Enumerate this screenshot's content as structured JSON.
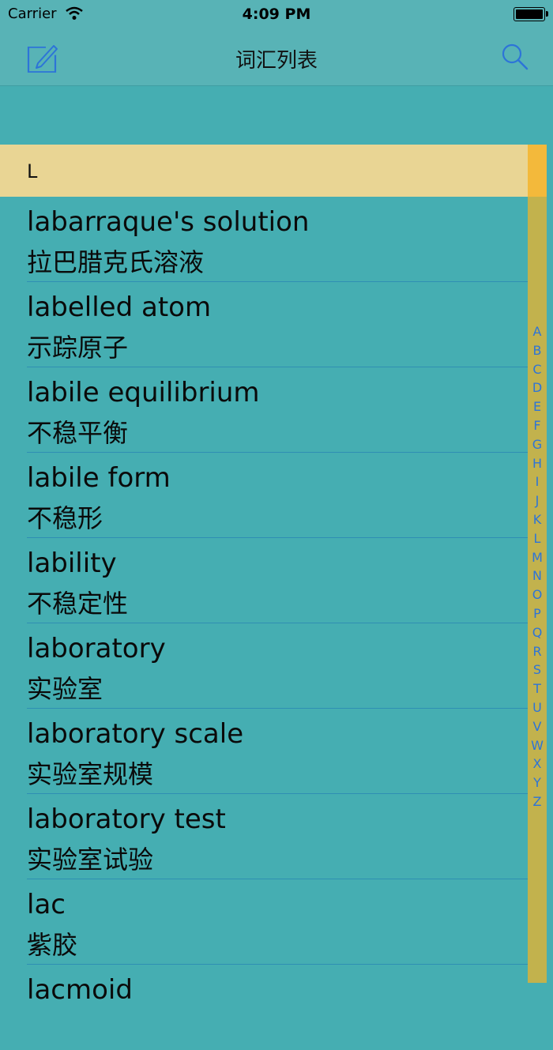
{
  "status": {
    "carrier": "Carrier",
    "time": "4:09 PM"
  },
  "nav": {
    "title": "词汇列表"
  },
  "section": {
    "letter": "L"
  },
  "words": [
    {
      "term": "labarraque's solution",
      "meaning": "拉巴腊克氏溶液"
    },
    {
      "term": "labelled atom",
      "meaning": "示踪原子"
    },
    {
      "term": "labile equilibrium",
      "meaning": "不稳平衡"
    },
    {
      "term": "labile form",
      "meaning": "不稳形"
    },
    {
      "term": "lability",
      "meaning": "不稳定性"
    },
    {
      "term": "laboratory",
      "meaning": "实验室"
    },
    {
      "term": "laboratory scale",
      "meaning": "实验室规模"
    },
    {
      "term": "laboratory test",
      "meaning": "实验室试验"
    },
    {
      "term": "lac",
      "meaning": "紫胶"
    },
    {
      "term": "lacmoid",
      "meaning": ""
    }
  ],
  "index": [
    "A",
    "B",
    "C",
    "D",
    "E",
    "F",
    "G",
    "H",
    "I",
    "J",
    "K",
    "L",
    "M",
    "N",
    "O",
    "P",
    "Q",
    "R",
    "S",
    "T",
    "U",
    "V",
    "W",
    "X",
    "Y",
    "Z"
  ],
  "colors": {
    "accent": "#2d74d8",
    "background": "#45aeb2",
    "section_header": "#e9d594",
    "index_bar": "#c2b24d",
    "index_current": "#f3b93b"
  }
}
